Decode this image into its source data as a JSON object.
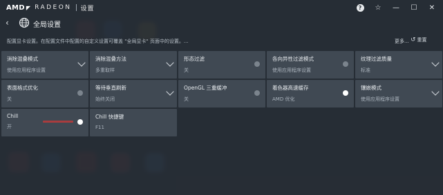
{
  "app": {
    "brand": "AMD",
    "product": "RADEON",
    "section": "设置"
  },
  "window_controls": {
    "help": "?",
    "favorite": "☆",
    "minimize": "—",
    "maximize": "☐",
    "close": "✕"
  },
  "header": {
    "back": "‹",
    "title": "全局设置"
  },
  "description": "配置显卡设置。在配置文件中配置的自定义设置可覆盖 \"全局显卡\" 页面中的设置。...",
  "toolbar": {
    "more_label": "更多...",
    "reset_label": "重置"
  },
  "tiles": [
    {
      "label": "消除混叠模式",
      "value": "使用应用程序设置",
      "control": "chevron"
    },
    {
      "label": "消除混叠方法",
      "value": "多重取样",
      "control": "chevron"
    },
    {
      "label": "形态过滤",
      "value": "关",
      "control": "toggle-off"
    },
    {
      "label": "各向异性过滤模式",
      "value": "使用应用程序设置",
      "control": "toggle-off"
    },
    {
      "label": "纹理过滤质量",
      "value": "标准",
      "control": "chevron"
    },
    {
      "label": "表面格式优化",
      "value": "关",
      "control": "toggle-off"
    },
    {
      "label": "等待垂直刷新",
      "value": "始终关闭",
      "control": "chevron"
    },
    {
      "label": "OpenGL 三重缓冲",
      "value": "关",
      "control": "toggle-off"
    },
    {
      "label": "着色器高速缓存",
      "value": "AMD 优化",
      "control": "toggle-on"
    },
    {
      "label": "镶嵌模式",
      "value": "使用应用程序设置",
      "control": "chevron"
    },
    {
      "label": "Chill",
      "value": "开",
      "control": "toggle-on"
    },
    {
      "label": "Chill 快捷键",
      "value": "F11",
      "control": "none"
    }
  ],
  "colors": {
    "tile_bg": "#404953",
    "page_bg": "#2a3038",
    "toggle_on": "#ffffff",
    "toggle_off": "#7b848d"
  }
}
